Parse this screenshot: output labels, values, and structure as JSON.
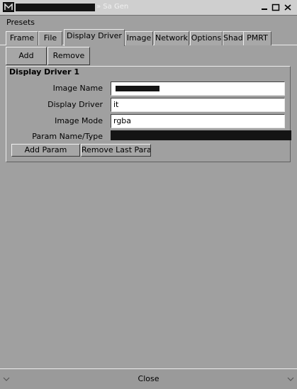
{
  "window": {
    "title": "» Sa Gen",
    "title_mark_icon": "app-logo-icon",
    "controls": [
      "minimize-icon",
      "maximize-icon",
      "close-icon"
    ]
  },
  "menu": {
    "presets": "Presets"
  },
  "tabs": [
    {
      "label": "Frame",
      "active": false
    },
    {
      "label": "File",
      "active": false
    },
    {
      "label": "Display Driver",
      "active": true
    },
    {
      "label": "Image",
      "active": false
    },
    {
      "label": "Network",
      "active": false
    },
    {
      "label": "Options",
      "active": false
    },
    {
      "label": "Shaders",
      "active": false
    },
    {
      "label": "PMRT",
      "active": false
    }
  ],
  "toolbar": {
    "add_label": "Add",
    "remove_label": "Remove"
  },
  "group": {
    "title": "Display Driver 1",
    "fields": [
      {
        "label": "Image Name",
        "value": ""
      },
      {
        "label": "Display Driver",
        "value": "it"
      },
      {
        "label": "Image Mode",
        "value": "rgba"
      },
      {
        "label": "Param Name/Type",
        "value": ""
      }
    ],
    "add_param_label": "Add Param",
    "remove_param_label": "Remove Last Param"
  },
  "footer": {
    "close_label": "Close"
  },
  "colors": {
    "window_bg": "#a0a0a0",
    "input_bg": "#ffffff",
    "redaction": "#141414"
  }
}
